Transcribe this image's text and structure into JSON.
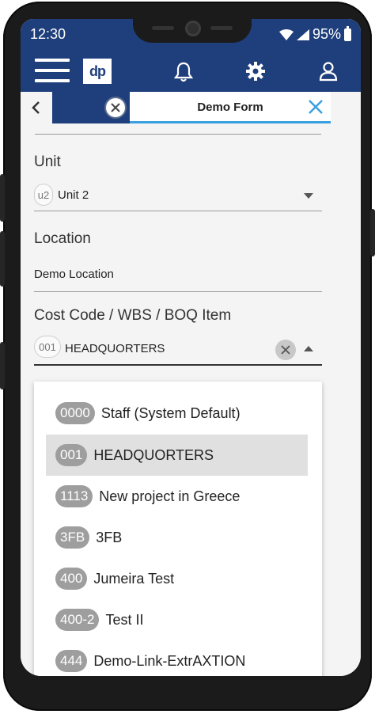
{
  "status_bar": {
    "time": "12:30",
    "battery": "95%"
  },
  "app_bar": {
    "logo": "dp",
    "icons": [
      "menu-icon",
      "bell-icon",
      "gear-icon",
      "user-icon"
    ]
  },
  "tabs": {
    "active_label": "Demo Form"
  },
  "form": {
    "unit": {
      "label": "Unit",
      "chip": "u2",
      "value": "Unit 2"
    },
    "location": {
      "label": "Location",
      "value": "Demo Location"
    },
    "cost_code": {
      "label": "Cost Code / WBS / BOQ Item",
      "chip": "001",
      "value": "HEADQUORTERS"
    }
  },
  "dropdown": {
    "options": [
      {
        "code": "0000",
        "label": "Staff (System Default)"
      },
      {
        "code": "001",
        "label": "HEADQUORTERS"
      },
      {
        "code": "1113",
        "label": "New project in Greece"
      },
      {
        "code": "3FB",
        "label": "3FB"
      },
      {
        "code": "400",
        "label": "Jumeira Test"
      },
      {
        "code": "400-2",
        "label": "Test II"
      },
      {
        "code": "444",
        "label": "Demo-Link-ExtrAXTION"
      }
    ],
    "selected_index": 1
  },
  "colors": {
    "brand": "#1f3f7c",
    "accent": "#3aa0e0",
    "selected_row": "#e0e0e0",
    "chip": "#9e9e9e"
  }
}
